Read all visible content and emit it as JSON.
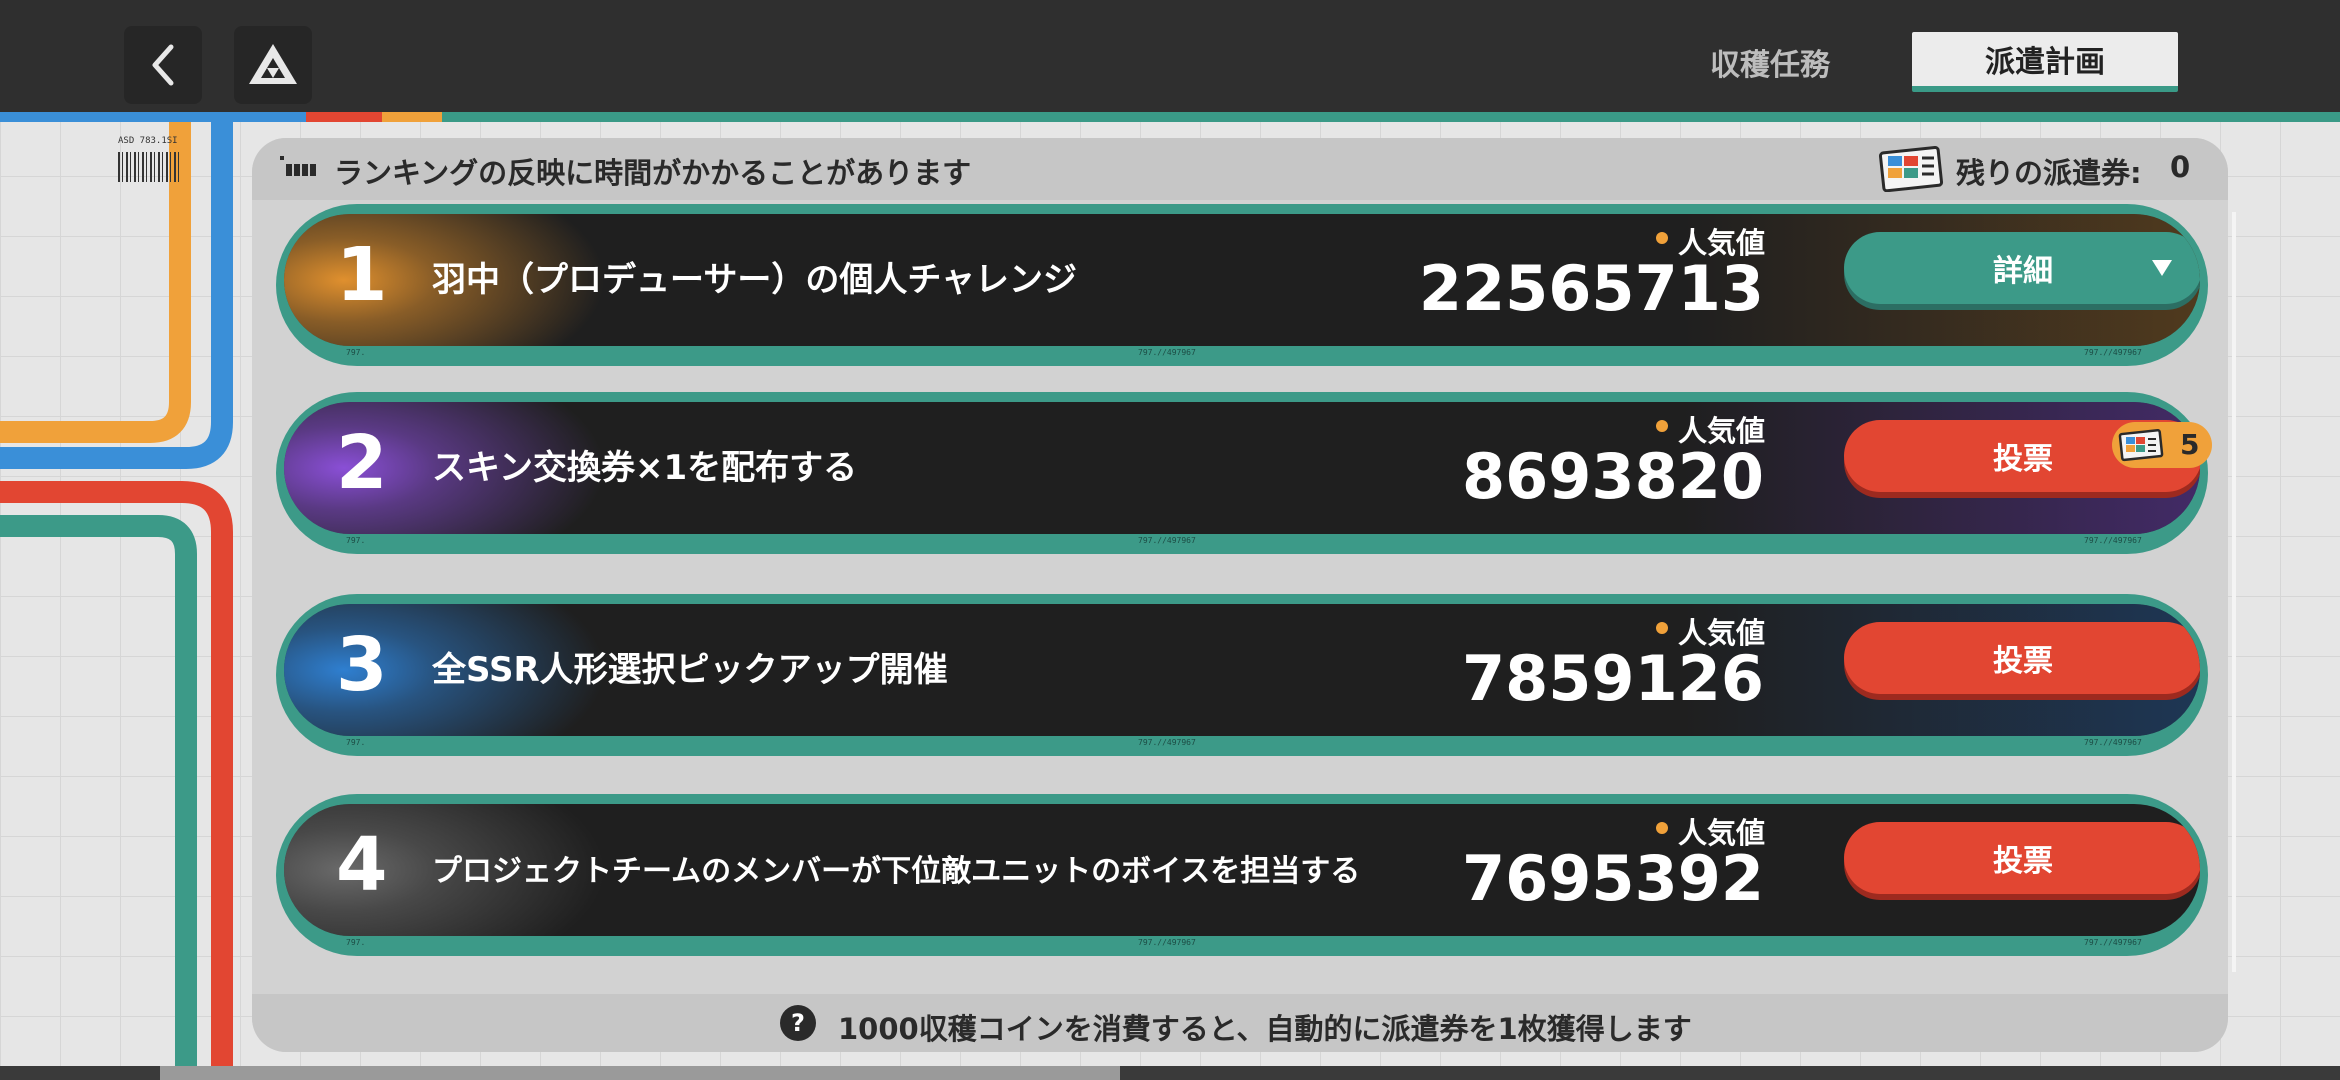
{
  "header": {
    "back_icon": "chevron-left-icon",
    "logo_icon": "triangle-logo-icon",
    "tabs": [
      {
        "label": "収穫任務",
        "active": false
      },
      {
        "label": "派遣計画",
        "active": true
      }
    ]
  },
  "notice": {
    "text": "ランキングの反映に時間がかかることがあります",
    "tickets_label": "残りの派遣券:",
    "tickets_value": "0"
  },
  "rows": [
    {
      "rank": "1",
      "title": "羽中（プロデューサー）の個人チャレンジ",
      "popularity_label": "人気値",
      "popularity": "22565713",
      "action": "詳細",
      "action_type": "detail",
      "glow": "#e0902e"
    },
    {
      "rank": "2",
      "title": "スキン交換券×1を配布する",
      "popularity_label": "人気値",
      "popularity": "8693820",
      "action": "投票",
      "action_type": "vote",
      "cost": "5",
      "glow": "#8a4fd6"
    },
    {
      "rank": "3",
      "title": "全SSR人形選択ピックアップ開催",
      "popularity_label": "人気値",
      "popularity": "7859126",
      "action": "投票",
      "action_type": "vote",
      "glow": "#2f7fd0"
    },
    {
      "rank": "4",
      "title": "プロジェクトチームのメンバーが下位敵ユニットのボイスを担当する",
      "popularity_label": "人気値",
      "popularity": "7695392",
      "action": "投票",
      "action_type": "vote",
      "glow": "#6a6a6a"
    }
  ],
  "footer": {
    "help_icon": "question-icon",
    "help_glyph": "?",
    "text": "1000収穫コインを消費すると、自動的に派遣券を1枚獲得します"
  },
  "colors": {
    "accent_teal": "#3c9a88",
    "vote_red": "#e24632",
    "gold": "#f0a13a"
  }
}
